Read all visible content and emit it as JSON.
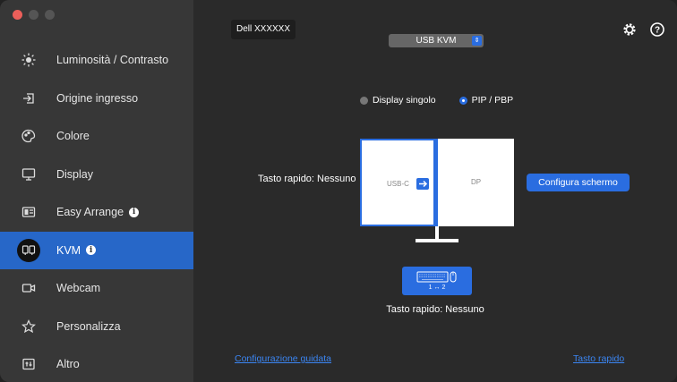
{
  "sidebar": {
    "items": [
      {
        "label": "Luminosità / Contrasto",
        "icon": "sun-icon"
      },
      {
        "label": "Origine ingresso",
        "icon": "input-source-icon"
      },
      {
        "label": "Colore",
        "icon": "color-palette-icon"
      },
      {
        "label": "Display",
        "icon": "monitor-icon"
      },
      {
        "label": "Easy Arrange",
        "icon": "layout-icon",
        "info": true
      },
      {
        "label": "KVM",
        "icon": "kvm-icon",
        "info": true,
        "active": true
      },
      {
        "label": "Webcam",
        "icon": "webcam-icon"
      },
      {
        "label": "Personalizza",
        "icon": "star-icon"
      },
      {
        "label": "Altro",
        "icon": "more-icon"
      }
    ]
  },
  "header": {
    "monitor_name": "Dell XXXXXX",
    "mode_select": "USB KVM"
  },
  "main": {
    "radio_single": "Display singolo",
    "radio_pip": "PIP / PBP",
    "hotkey_left": "Tasto rapido: Nessuno",
    "left_pane": "USB-C",
    "right_pane": "DP",
    "config_button": "Configura schermo",
    "kvm_tile_label": "1 ↔ 2",
    "hotkey_bottom": "Tasto rapido: Nessuno",
    "link_wizard": "Configurazione guidata",
    "link_hotkey": "Tasto rapido"
  },
  "colors": {
    "accent": "#2a6de0",
    "link": "#3b85f2",
    "sidebar_bg": "#373737",
    "main_bg": "#2a2a2a"
  }
}
